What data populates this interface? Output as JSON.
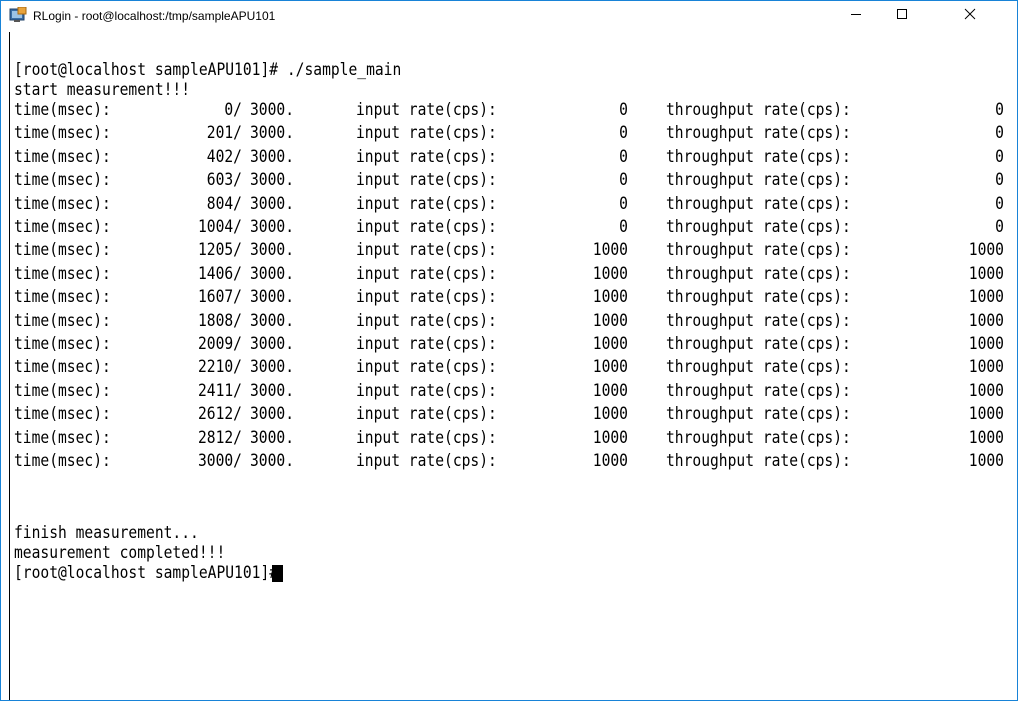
{
  "window": {
    "title": "RLogin - root@localhost:/tmp/sampleAPU101",
    "icon": "rlogin-app-icon"
  },
  "controls": {
    "minimize_icon": "minimize-icon",
    "maximize_icon": "maximize-icon",
    "close_icon": "close-icon"
  },
  "terminal": {
    "prompt_line": "[root@localhost sampleAPU101]# ./sample_main",
    "start_line": "start measurement!!!",
    "rows": [
      {
        "label": "time(msec):",
        "time": "0/",
        "total": "3000.",
        "input_label": "input rate(cps):",
        "input": "0",
        "throughput_label": "throughput rate(cps):",
        "throughput": "0"
      },
      {
        "label": "time(msec):",
        "time": "201/",
        "total": "3000.",
        "input_label": "input rate(cps):",
        "input": "0",
        "throughput_label": "throughput rate(cps):",
        "throughput": "0"
      },
      {
        "label": "time(msec):",
        "time": "402/",
        "total": "3000.",
        "input_label": "input rate(cps):",
        "input": "0",
        "throughput_label": "throughput rate(cps):",
        "throughput": "0"
      },
      {
        "label": "time(msec):",
        "time": "603/",
        "total": "3000.",
        "input_label": "input rate(cps):",
        "input": "0",
        "throughput_label": "throughput rate(cps):",
        "throughput": "0"
      },
      {
        "label": "time(msec):",
        "time": "804/",
        "total": "3000.",
        "input_label": "input rate(cps):",
        "input": "0",
        "throughput_label": "throughput rate(cps):",
        "throughput": "0"
      },
      {
        "label": "time(msec):",
        "time": "1004/",
        "total": "3000.",
        "input_label": "input rate(cps):",
        "input": "0",
        "throughput_label": "throughput rate(cps):",
        "throughput": "0"
      },
      {
        "label": "time(msec):",
        "time": "1205/",
        "total": "3000.",
        "input_label": "input rate(cps):",
        "input": "1000",
        "throughput_label": "throughput rate(cps):",
        "throughput": "1000"
      },
      {
        "label": "time(msec):",
        "time": "1406/",
        "total": "3000.",
        "input_label": "input rate(cps):",
        "input": "1000",
        "throughput_label": "throughput rate(cps):",
        "throughput": "1000"
      },
      {
        "label": "time(msec):",
        "time": "1607/",
        "total": "3000.",
        "input_label": "input rate(cps):",
        "input": "1000",
        "throughput_label": "throughput rate(cps):",
        "throughput": "1000"
      },
      {
        "label": "time(msec):",
        "time": "1808/",
        "total": "3000.",
        "input_label": "input rate(cps):",
        "input": "1000",
        "throughput_label": "throughput rate(cps):",
        "throughput": "1000"
      },
      {
        "label": "time(msec):",
        "time": "2009/",
        "total": "3000.",
        "input_label": "input rate(cps):",
        "input": "1000",
        "throughput_label": "throughput rate(cps):",
        "throughput": "1000"
      },
      {
        "label": "time(msec):",
        "time": "2210/",
        "total": "3000.",
        "input_label": "input rate(cps):",
        "input": "1000",
        "throughput_label": "throughput rate(cps):",
        "throughput": "1000"
      },
      {
        "label": "time(msec):",
        "time": "2411/",
        "total": "3000.",
        "input_label": "input rate(cps):",
        "input": "1000",
        "throughput_label": "throughput rate(cps):",
        "throughput": "1000"
      },
      {
        "label": "time(msec):",
        "time": "2612/",
        "total": "3000.",
        "input_label": "input rate(cps):",
        "input": "1000",
        "throughput_label": "throughput rate(cps):",
        "throughput": "1000"
      },
      {
        "label": "time(msec):",
        "time": "2812/",
        "total": "3000.",
        "input_label": "input rate(cps):",
        "input": "1000",
        "throughput_label": "throughput rate(cps):",
        "throughput": "1000"
      },
      {
        "label": "time(msec):",
        "time": "3000/",
        "total": "3000.",
        "input_label": "input rate(cps):",
        "input": "1000",
        "throughput_label": "throughput rate(cps):",
        "throughput": "1000"
      }
    ],
    "finish_line": "finish measurement...",
    "completed_line": "measurement completed!!!",
    "final_prompt": "[root@localhost sampleAPU101]#"
  }
}
